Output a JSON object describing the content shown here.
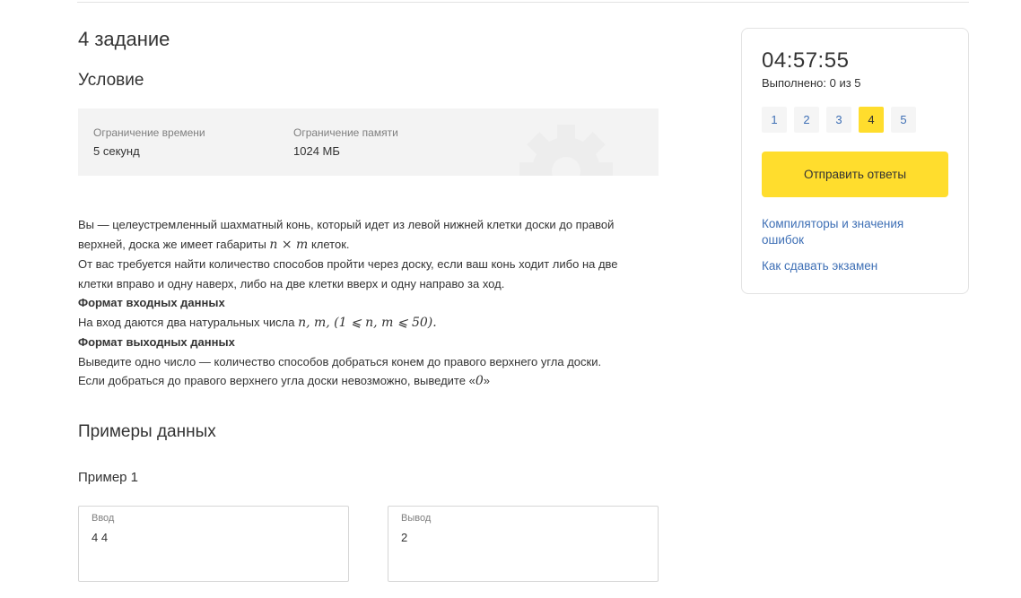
{
  "task": {
    "title": "4 задание",
    "condition_heading": "Условие"
  },
  "limits": {
    "time_label": "Ограничение времени",
    "time_value": "5 секунд",
    "memory_label": "Ограничение памяти",
    "memory_value": "1024 МБ"
  },
  "statement": {
    "line1": "Вы — целеустремленный шахматный конь, который идет из левой нижней клетки доски до правой",
    "line2_text": "верхней, доска же имеет габариты ",
    "line2_math": "n × m",
    "line2_end": " клеток.",
    "line3": "От вас требуется найти количество способов пройти через доску, если ваш конь ходит либо на две",
    "line4": "клетки вправо и одну наверх, либо на две клетки вверх и одну направо за ход.",
    "input_heading": "Формат входных данных",
    "input_text": "На вход даются два натуральных числа ",
    "input_math": "n, m, (1 ⩽ n, m ⩽ 50).",
    "output_heading": "Формат выходных данных",
    "output_line1": "Выведите одно число — количество способов добраться конем до правого верхнего угла доски.",
    "output_line2_text": "Если добраться до правого верхнего угла доски невозможно, выведите «",
    "output_line2_math": "0",
    "output_line2_end": "»"
  },
  "examples": {
    "heading": "Примеры данных",
    "example1_title": "Пример 1",
    "input_label": "Ввод",
    "input_value": "4 4",
    "output_label": "Вывод",
    "output_value": "2"
  },
  "sidebar": {
    "timer": "04:57:55",
    "progress": "Выполнено: 0 из 5",
    "tasks": [
      "1",
      "2",
      "3",
      "4",
      "5"
    ],
    "active_task": "4",
    "submit_label": "Отправить ответы",
    "link_compilers_line1": "Компиляторы и значения",
    "link_compilers_line2": "ошибок",
    "link_exam": "Как сдавать экзамен"
  },
  "colors": {
    "accent": "#ffdd2d",
    "link": "#3e6fb5",
    "limits_bg": "#f3f3f3"
  }
}
